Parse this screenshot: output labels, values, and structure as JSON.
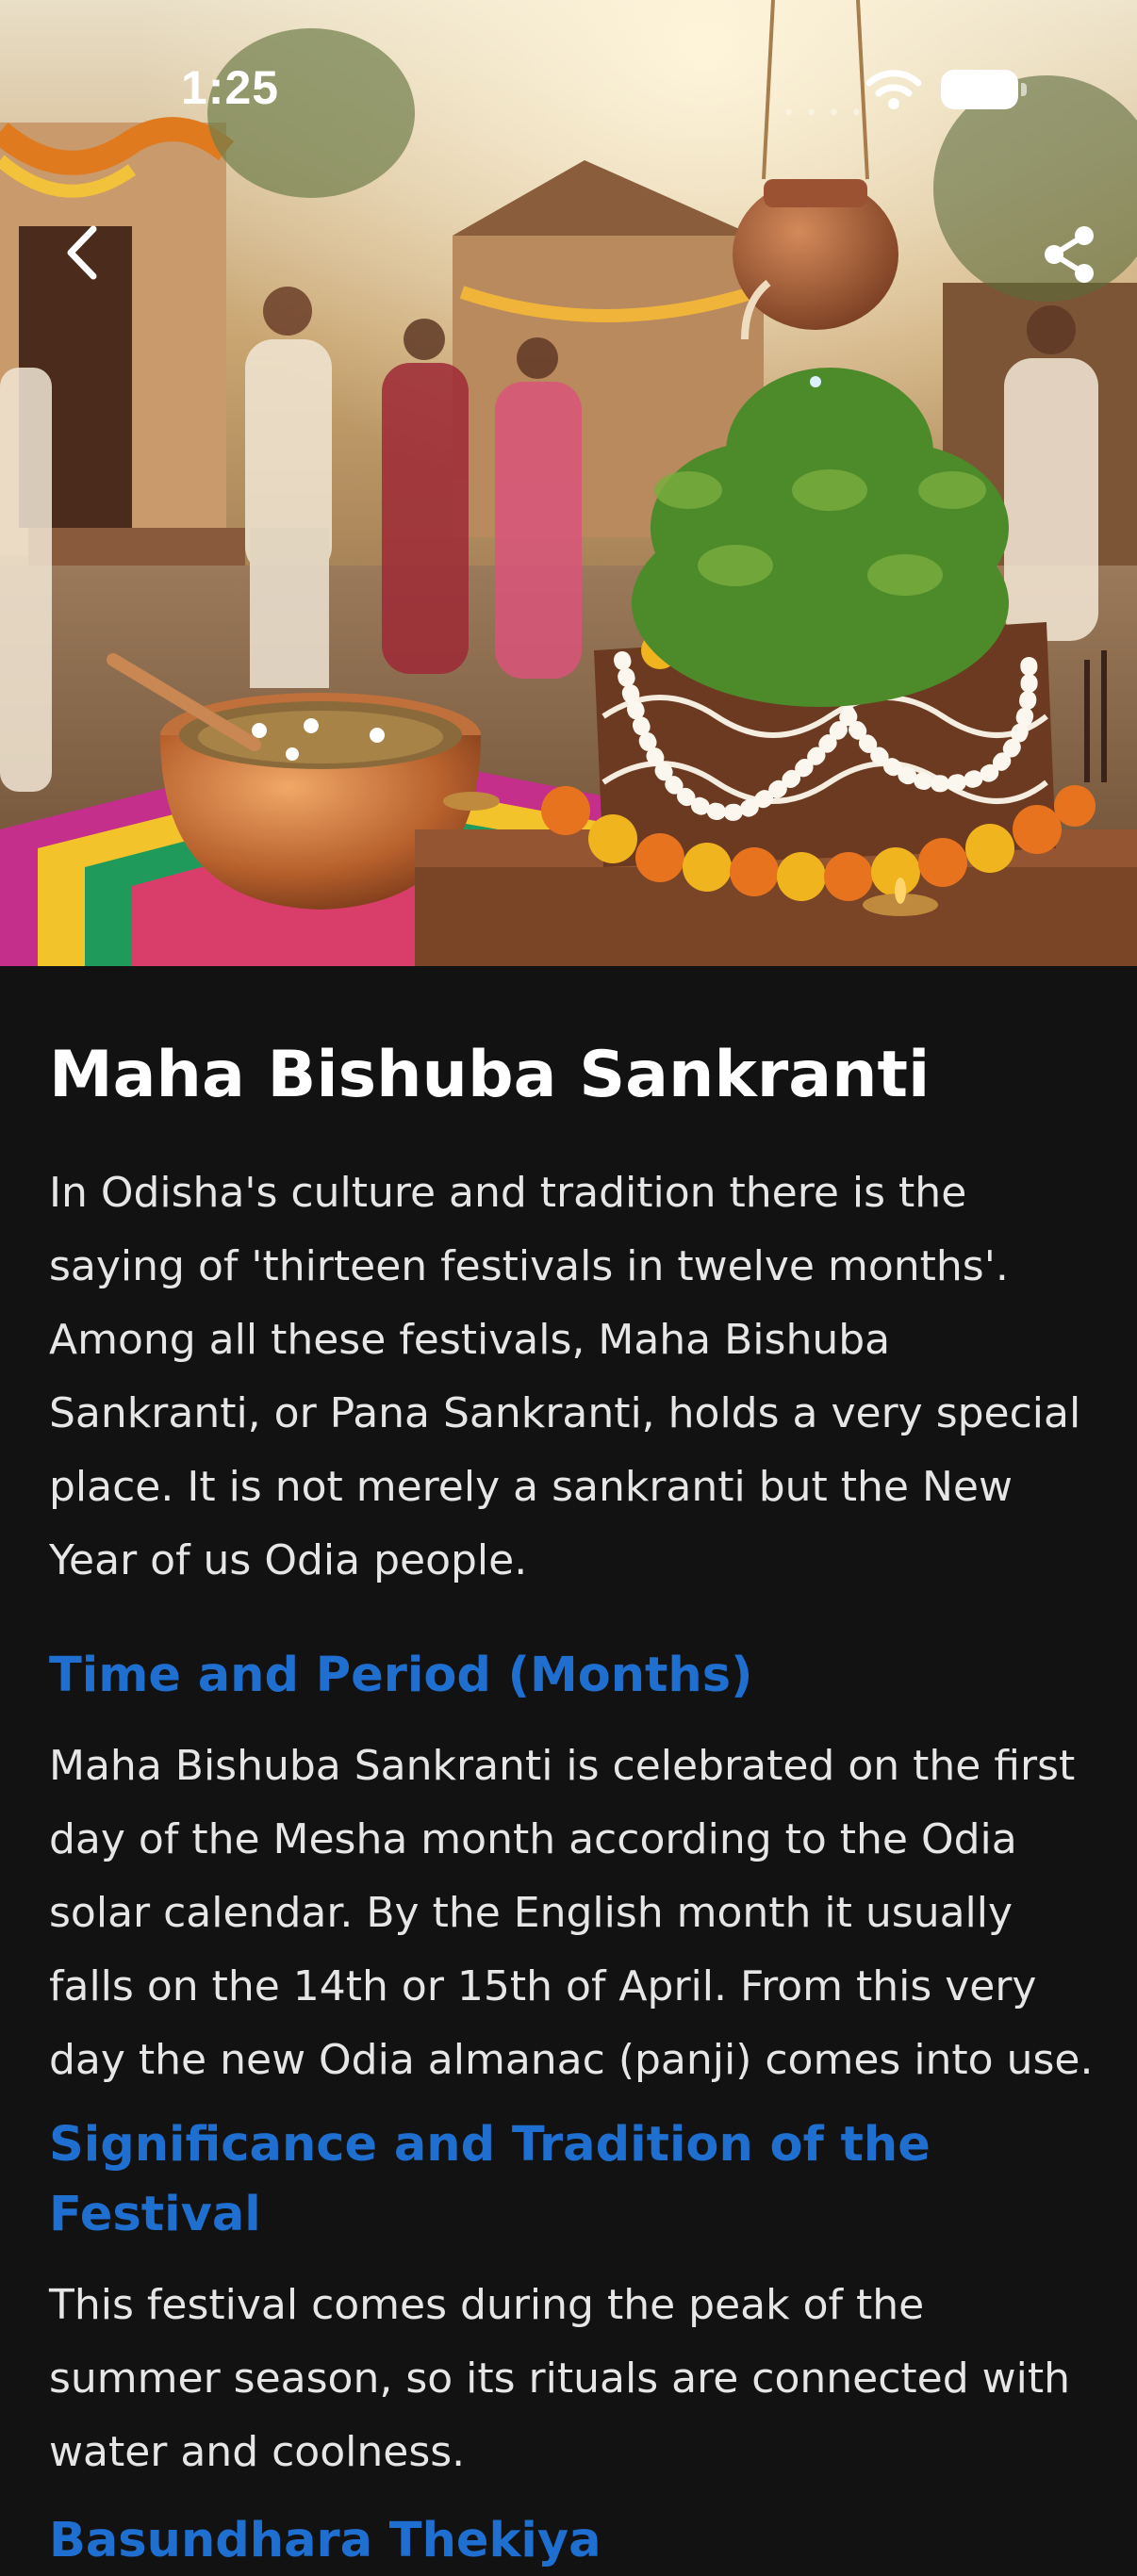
{
  "status_bar": {
    "time": "1:25"
  },
  "article": {
    "title": "Maha Bishuba Sankranti",
    "intro": "In Odisha's culture and tradition there is the saying of 'thirteen festivals in twelve months'. Among all these festivals, Maha Bishuba Sankranti, or Pana Sankranti, holds a very special place. It is not merely a sankranti but the New Year of us Odia people.",
    "sections": [
      {
        "heading": "Time and Period (Months)",
        "body": "Maha Bishuba Sankranti is celebrated on the first day of the Mesha month according to the Odia solar calendar. By the English month it usually falls on the 14th or 15th of April. From this very day the new Odia almanac (panji) comes into use."
      },
      {
        "heading": "Significance and Tradition of the Festival",
        "body": "This festival comes during the peak of the summer season, so its rituals are connected with water and coolness."
      },
      {
        "heading": "Basundhara Thekiya"
      }
    ]
  },
  "icons": {
    "back": "chevron-left-icon",
    "share": "share-icon"
  },
  "colors": {
    "background": "#121212",
    "heading": "#1e6fd0",
    "text": "#e6e6e6"
  }
}
